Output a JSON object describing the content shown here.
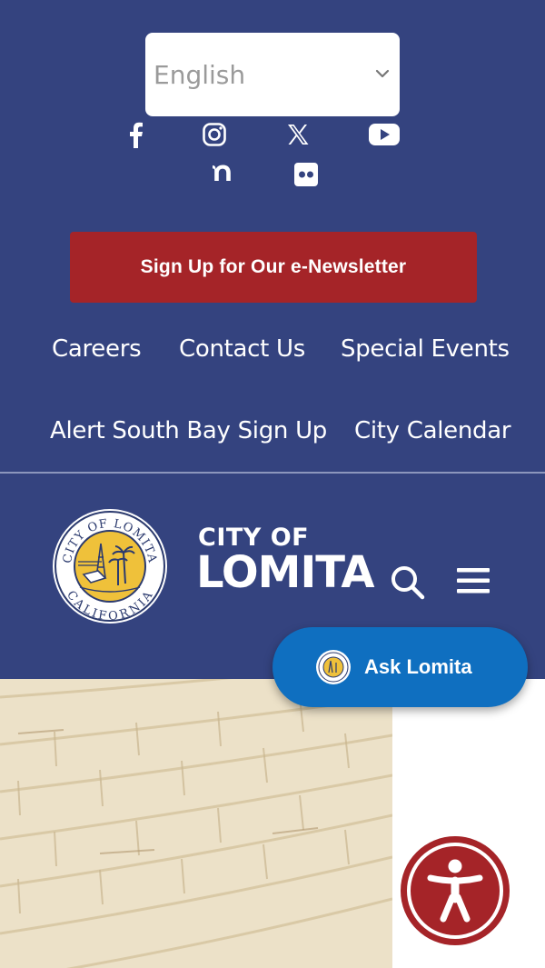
{
  "language_select": {
    "value": "English"
  },
  "social": [
    "facebook-icon",
    "instagram-icon",
    "x-icon",
    "youtube-icon",
    "nextdoor-icon",
    "flickr-icon"
  ],
  "newsletter": {
    "label": "Sign Up for Our e-Newsletter",
    "color": "#a52428"
  },
  "quick_links": [
    "Careers",
    "Contact Us",
    "Special Events",
    "Alert South Bay Sign Up",
    "City Calendar"
  ],
  "brand": {
    "top": "CITY OF",
    "main": "LOMITA"
  },
  "seal": {
    "top_text": "CITY OF LOMITA",
    "bottom_text": "CALIFORNIA"
  },
  "ask": {
    "label": "Ask Lomita"
  },
  "colors": {
    "primary": "#34437f",
    "accent_red": "#a52428",
    "chat_blue": "#0f6fc0"
  }
}
